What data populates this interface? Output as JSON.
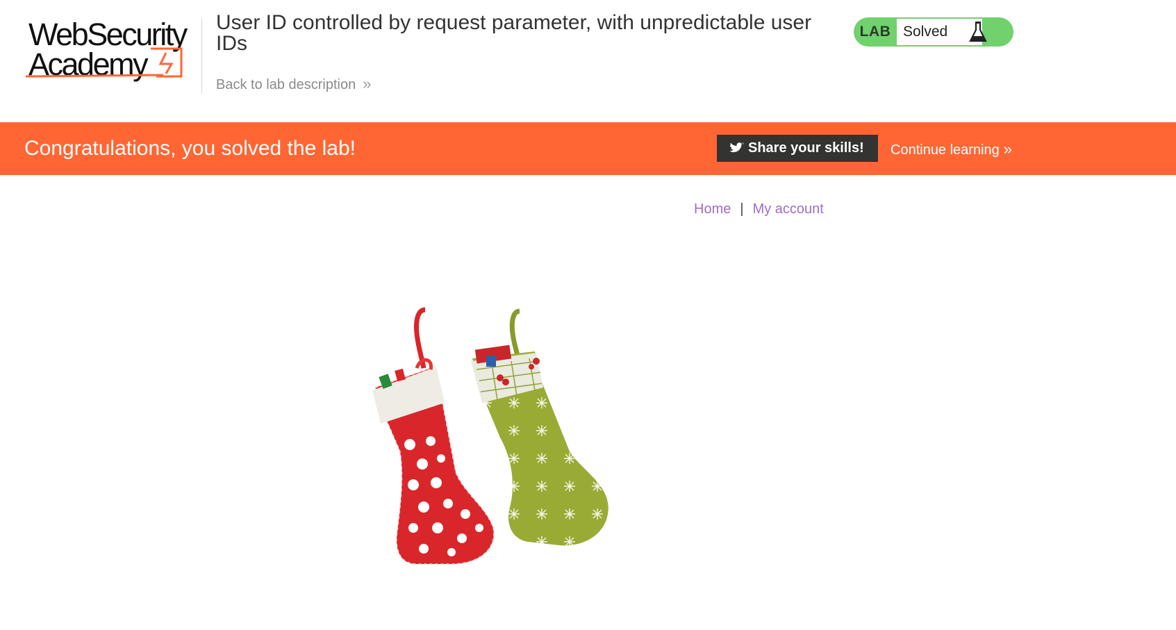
{
  "header": {
    "logo_line1": "WebSecurity",
    "logo_line2": "Academy",
    "logo_icon": "lightning-bolt-icon",
    "title": "User ID controlled by request parameter, with unpredictable user IDs",
    "back_link": "Back to lab description",
    "back_icon": "double-chevron-right-icon"
  },
  "status": {
    "lab_label": "LAB",
    "status_text": "Solved",
    "icon": "flask-icon",
    "color": "#70d16d"
  },
  "banner": {
    "message": "Congratulations, you solved the lab!",
    "share_label": "Share your skills!",
    "share_icon": "twitter-icon",
    "continue_label": "Continue learning",
    "color": "#ff6633"
  },
  "nav": {
    "home": "Home",
    "separator": "|",
    "my_account": "My account"
  },
  "main": {
    "image_subject": "christmas-stockings-image"
  }
}
